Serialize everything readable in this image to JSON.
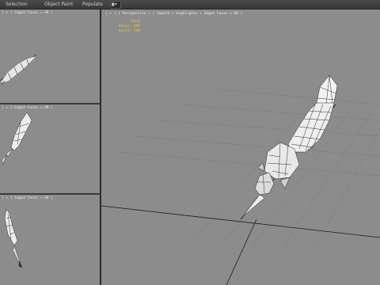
{
  "menu": {
    "items": [
      "Selection",
      "Object Paint",
      "Populate"
    ],
    "dropdown_icon": "camera-icon",
    "dropdown_glyph": "▣▾"
  },
  "viewports": {
    "top_left": {
      "label": "[ +  ] Edged Faces + HR ]"
    },
    "mid_left": {
      "label": "[ +  ] Edged Faces + HR ]"
    },
    "bot_left": {
      "label": "[ +  ] Edged Faces + HR ]"
    },
    "main": {
      "label": "[ + ] [ Perspective ] [ Smooth + Highlights + Edged Faces + HR ]",
      "stats": {
        "title": "Total",
        "polys": "Polys: 695",
        "verts": "Verts: 590"
      }
    }
  },
  "colors": {
    "viewport_bg": "#8c8c8c",
    "wire": "#ffffff",
    "stats": "#e8d23a",
    "frame": "#2a2a2a"
  }
}
